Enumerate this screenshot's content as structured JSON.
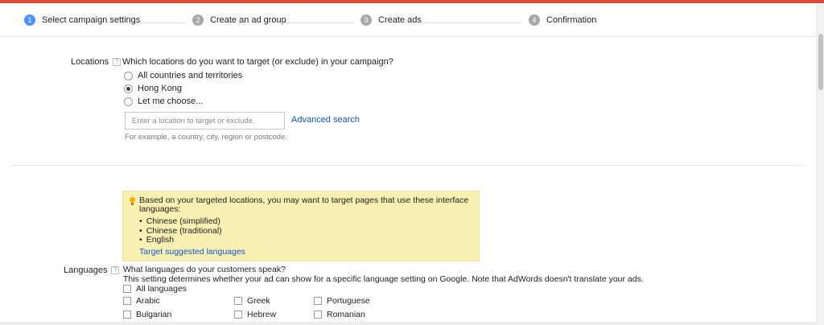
{
  "stepper": {
    "steps": [
      {
        "num": "1",
        "label": "Select campaign settings"
      },
      {
        "num": "2",
        "label": "Create an ad group"
      },
      {
        "num": "3",
        "label": "Create ads"
      },
      {
        "num": "4",
        "label": "Confirmation"
      }
    ],
    "active_step": 1
  },
  "locations": {
    "label": "Locations",
    "help": "?",
    "question": "Which locations do you want to target (or exclude) in your campaign?",
    "options": [
      {
        "label": "All countries and territories",
        "checked": false
      },
      {
        "label": "Hong Kong",
        "checked": true
      },
      {
        "label": "Let me choose...",
        "checked": false
      }
    ],
    "input_placeholder": "Enter a location to target or exclude.",
    "input_value": "",
    "advanced_link": "Advanced search",
    "hint": "For example, a country, city, region or postcode."
  },
  "suggestion": {
    "text": "Based on your targeted locations, you may want to target pages that use these interface languages:",
    "languages": [
      "Chinese (simplified)",
      "Chinese (traditional)",
      "English"
    ],
    "link": "Target suggested languages"
  },
  "languages": {
    "label": "Languages",
    "help": "?",
    "question": "What languages do your customers speak?",
    "note": "This setting determines whether your ad can show for a specific language setting on Google. Note that AdWords doesn't translate your ads.",
    "all_label": "All languages",
    "columns": [
      [
        "Arabic",
        "Bulgarian"
      ],
      [
        "Greek",
        "Hebrew"
      ],
      [
        "Portuguese",
        "Romanian"
      ]
    ]
  },
  "colors": {
    "top_bar": "#dd4b39",
    "active_step": "#4d90fe",
    "link": "#1155cc",
    "suggestion_bg": "#f8efb2"
  }
}
